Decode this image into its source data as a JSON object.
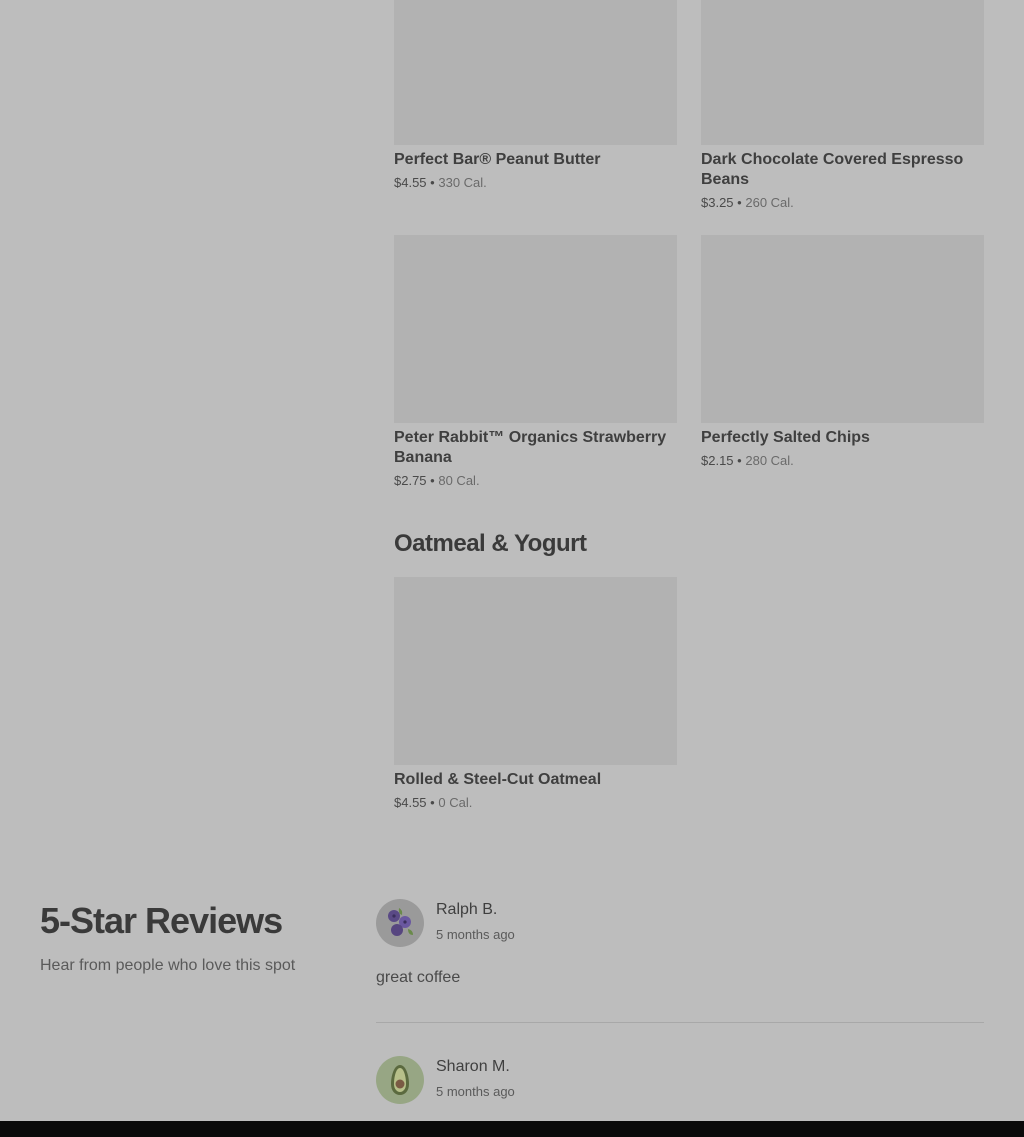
{
  "menu": {
    "items": [
      {
        "name": "Perfect Bar® Peanut Butter",
        "price": "$4.55",
        "sep": "•",
        "cal": "330 Cal."
      },
      {
        "name": "Dark Chocolate Covered Espresso Beans",
        "price": "$3.25",
        "sep": "•",
        "cal": "260 Cal."
      },
      {
        "name": "Peter Rabbit™ Organics Strawberry Banana",
        "price": "$2.75",
        "sep": "•",
        "cal": "80 Cal."
      },
      {
        "name": "Perfectly Salted Chips",
        "price": "$2.15",
        "sep": "•",
        "cal": "280 Cal."
      }
    ],
    "oatmeal_section": {
      "title": "Oatmeal & Yogurt",
      "items": [
        {
          "name": "Rolled & Steel-Cut Oatmeal",
          "price": "$4.55",
          "sep": "•",
          "cal": "0 Cal."
        }
      ]
    }
  },
  "reviews": {
    "title": "5-Star Reviews",
    "subtitle": "Hear from people who love this spot",
    "list": [
      {
        "name": "Ralph B.",
        "time": "5 months ago",
        "text": "great coffee",
        "avatar_icon": "blueberry-icon"
      },
      {
        "name": "Sharon M.",
        "time": "5 months ago",
        "avatar_icon": "avocado-icon"
      }
    ]
  },
  "colors": {
    "overlay_bg": "#bdbdbd",
    "image_placeholder": "#b2b2b2",
    "bottom_bar": "#0a0a0a"
  }
}
